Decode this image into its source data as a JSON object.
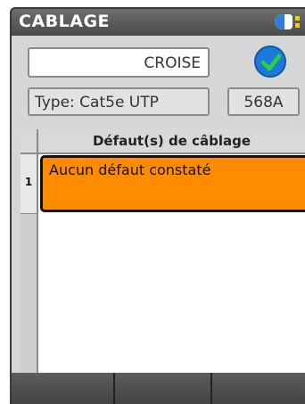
{
  "header": {
    "title": "CABLAGE",
    "battery_icon": "battery-icon"
  },
  "status": {
    "mode_value": "CROISE",
    "result_icon": "checkmark-icon",
    "result_color": "#1a7ad9"
  },
  "cable": {
    "type_label": "Type: Cat5e UTP",
    "standard": "568A"
  },
  "faults_table": {
    "header": "Défaut(s) de câblage",
    "rows": [
      {
        "index": "1",
        "text": "Aucun défaut constaté"
      }
    ],
    "highlight_color": "#ff8c00"
  },
  "softkeys": [
    {
      "label": ""
    },
    {
      "label": ""
    },
    {
      "label": ""
    }
  ]
}
